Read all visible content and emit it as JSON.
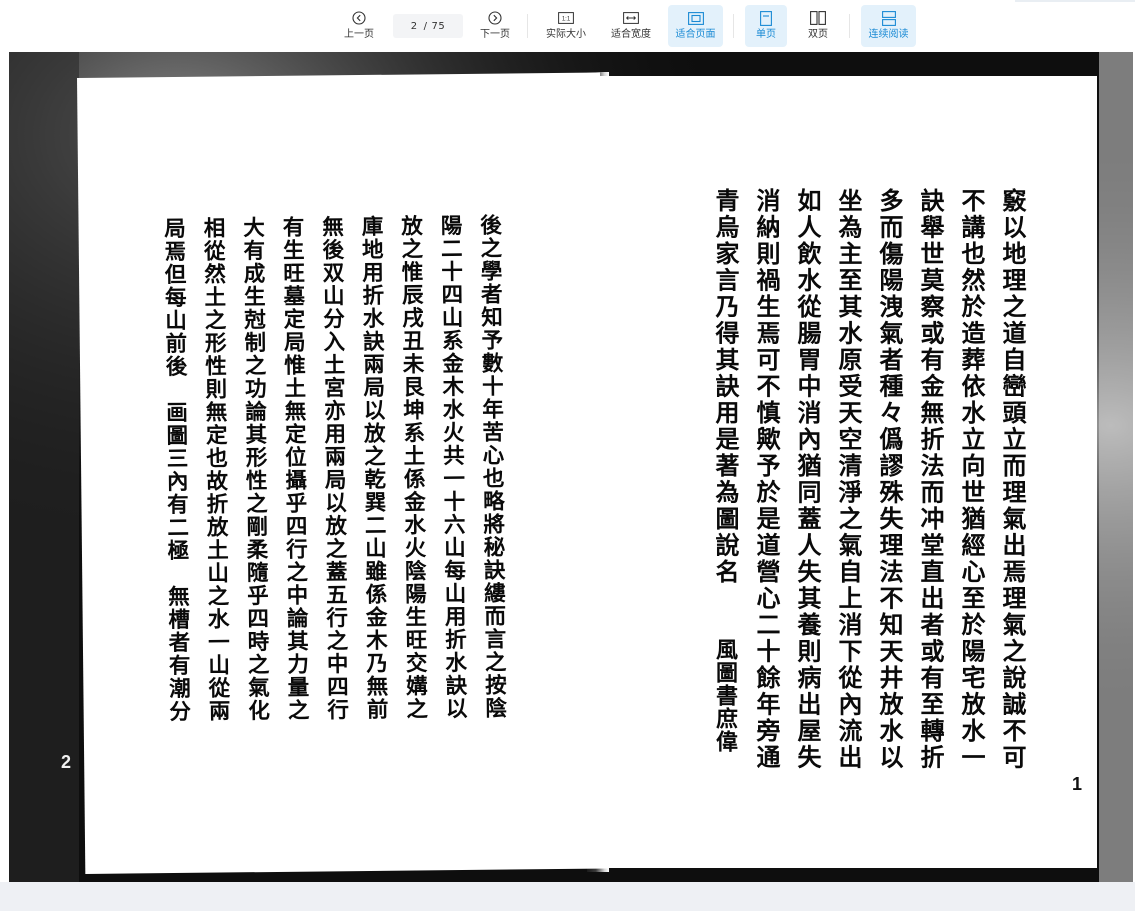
{
  "toolbar": {
    "prev_label": "上一页",
    "next_label": "下一页",
    "page_current": "2",
    "page_total": "75",
    "actual_size_label": "实际大小",
    "actual_size_icon_text": "1:1",
    "fit_width_label": "适合宽度",
    "fit_page_label": "适合页面",
    "single_page_label": "单页",
    "double_page_label": "双页",
    "continuous_label": "连续阅读",
    "active_color": "#1a8ad4",
    "active_bg": "#e3f1fb"
  },
  "document": {
    "right_page": {
      "columns": [
        "竅以地理之道自巒頭立而理氣出焉理氣之說誠不可",
        "不講也然於造葬依水立向世猶經心至於陽宅放水一",
        "訣舉世莫察或有金無折法而冲堂直出者或有至轉折",
        "多而傷陽洩氣者種々僞謬殊失理法不知天井放水以",
        "坐為主至其水原受天空清淨之氣自上消下從內流出",
        "如人飲水從腸胃中消內猶同蓋人失其養則病出屋失",
        "消納則禍生焉可不慎歟予於是道營心二十餘年旁通",
        "青烏家言乃得其訣用是著為圖說名"
      ],
      "signature": "風圖書庶偉",
      "page_number": "1"
    },
    "left_page": {
      "columns": [
        "後之學者知予數十年苦心也略將秘訣縷而言之按陰",
        "陽二十四山系金木水火共一十六山每山用折水訣以",
        "放之惟辰戌丑未艮坤系土係金水火陰陽生旺交媾之",
        "庫地用折水訣兩局以放之乾巽二山雖係金木乃無前",
        "無後双山分入土宮亦用兩局以放之蓋五行之中四行",
        "有生旺墓定局惟土無定位攝乎四行之中論其力量之",
        "大有成生尅制之功論其形性之剛柔隨乎四時之氣化",
        "相從然土之形性則無定也故折放土山之水一山從兩",
        "局焉但每山前後　画圖三內有二極　無槽者有潮分"
      ],
      "page_number": "2"
    }
  }
}
